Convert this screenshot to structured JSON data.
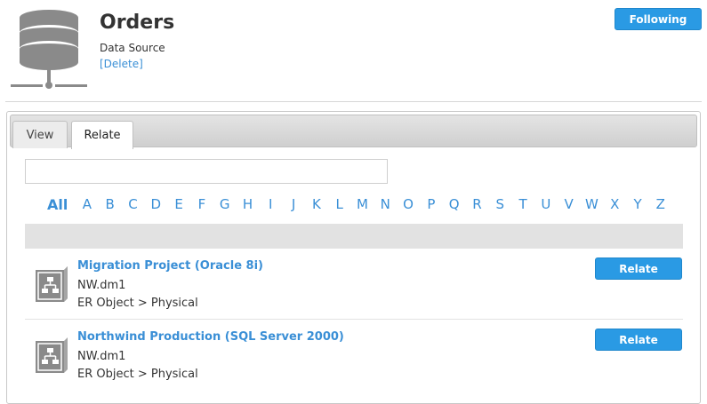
{
  "header": {
    "title": "Orders",
    "subtitle": "Data Source",
    "delete_label": "[Delete]",
    "follow_label": "Following",
    "icon": "database-network-icon"
  },
  "tabs": [
    {
      "label": "View",
      "active": false
    },
    {
      "label": "Relate",
      "active": true
    }
  ],
  "search": {
    "value": "",
    "placeholder": ""
  },
  "alphabet": [
    "All",
    "A",
    "B",
    "C",
    "D",
    "E",
    "F",
    "G",
    "H",
    "I",
    "J",
    "K",
    "L",
    "M",
    "N",
    "O",
    "P",
    "Q",
    "R",
    "S",
    "T",
    "U",
    "V",
    "W",
    "X",
    "Y",
    "Z"
  ],
  "results": [
    {
      "title": "Migration Project (Oracle 8i)",
      "file": "NW.dm1",
      "type": "ER Object > Physical",
      "button": "Relate",
      "icon": "er-diagram-icon"
    },
    {
      "title": "Northwind Production (SQL Server 2000)",
      "file": "NW.dm1",
      "type": "ER Object > Physical",
      "button": "Relate",
      "icon": "er-diagram-icon"
    }
  ],
  "colors": {
    "accent": "#2a9ae4",
    "link": "#3a8fd6",
    "icon_grey": "#8a8a8a"
  }
}
